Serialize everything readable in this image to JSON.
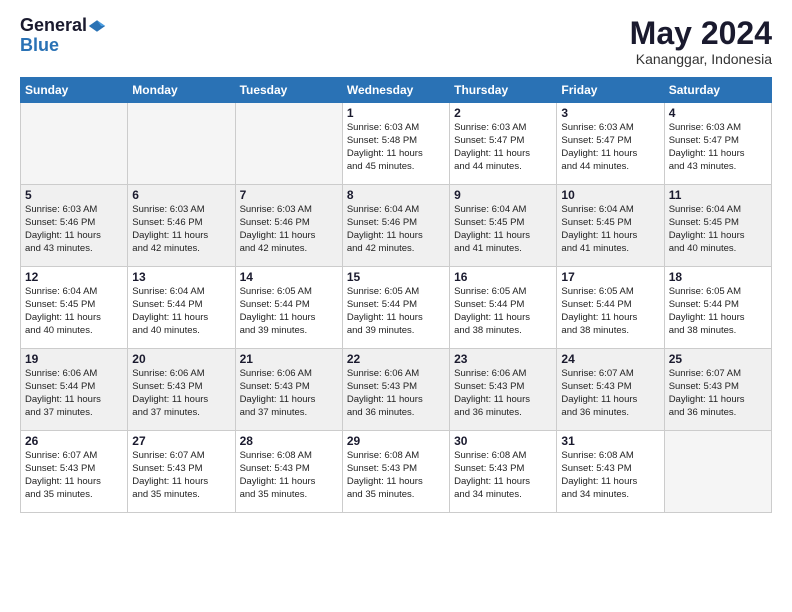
{
  "logo": {
    "general": "General",
    "blue": "Blue"
  },
  "header": {
    "month_year": "May 2024",
    "location": "Kananggar, Indonesia"
  },
  "weekdays": [
    "Sunday",
    "Monday",
    "Tuesday",
    "Wednesday",
    "Thursday",
    "Friday",
    "Saturday"
  ],
  "weeks": [
    [
      {
        "day": "",
        "info": ""
      },
      {
        "day": "",
        "info": ""
      },
      {
        "day": "",
        "info": ""
      },
      {
        "day": "1",
        "info": "Sunrise: 6:03 AM\nSunset: 5:48 PM\nDaylight: 11 hours\nand 45 minutes."
      },
      {
        "day": "2",
        "info": "Sunrise: 6:03 AM\nSunset: 5:47 PM\nDaylight: 11 hours\nand 44 minutes."
      },
      {
        "day": "3",
        "info": "Sunrise: 6:03 AM\nSunset: 5:47 PM\nDaylight: 11 hours\nand 44 minutes."
      },
      {
        "day": "4",
        "info": "Sunrise: 6:03 AM\nSunset: 5:47 PM\nDaylight: 11 hours\nand 43 minutes."
      }
    ],
    [
      {
        "day": "5",
        "info": "Sunrise: 6:03 AM\nSunset: 5:46 PM\nDaylight: 11 hours\nand 43 minutes."
      },
      {
        "day": "6",
        "info": "Sunrise: 6:03 AM\nSunset: 5:46 PM\nDaylight: 11 hours\nand 42 minutes."
      },
      {
        "day": "7",
        "info": "Sunrise: 6:03 AM\nSunset: 5:46 PM\nDaylight: 11 hours\nand 42 minutes."
      },
      {
        "day": "8",
        "info": "Sunrise: 6:04 AM\nSunset: 5:46 PM\nDaylight: 11 hours\nand 42 minutes."
      },
      {
        "day": "9",
        "info": "Sunrise: 6:04 AM\nSunset: 5:45 PM\nDaylight: 11 hours\nand 41 minutes."
      },
      {
        "day": "10",
        "info": "Sunrise: 6:04 AM\nSunset: 5:45 PM\nDaylight: 11 hours\nand 41 minutes."
      },
      {
        "day": "11",
        "info": "Sunrise: 6:04 AM\nSunset: 5:45 PM\nDaylight: 11 hours\nand 40 minutes."
      }
    ],
    [
      {
        "day": "12",
        "info": "Sunrise: 6:04 AM\nSunset: 5:45 PM\nDaylight: 11 hours\nand 40 minutes."
      },
      {
        "day": "13",
        "info": "Sunrise: 6:04 AM\nSunset: 5:44 PM\nDaylight: 11 hours\nand 40 minutes."
      },
      {
        "day": "14",
        "info": "Sunrise: 6:05 AM\nSunset: 5:44 PM\nDaylight: 11 hours\nand 39 minutes."
      },
      {
        "day": "15",
        "info": "Sunrise: 6:05 AM\nSunset: 5:44 PM\nDaylight: 11 hours\nand 39 minutes."
      },
      {
        "day": "16",
        "info": "Sunrise: 6:05 AM\nSunset: 5:44 PM\nDaylight: 11 hours\nand 38 minutes."
      },
      {
        "day": "17",
        "info": "Sunrise: 6:05 AM\nSunset: 5:44 PM\nDaylight: 11 hours\nand 38 minutes."
      },
      {
        "day": "18",
        "info": "Sunrise: 6:05 AM\nSunset: 5:44 PM\nDaylight: 11 hours\nand 38 minutes."
      }
    ],
    [
      {
        "day": "19",
        "info": "Sunrise: 6:06 AM\nSunset: 5:44 PM\nDaylight: 11 hours\nand 37 minutes."
      },
      {
        "day": "20",
        "info": "Sunrise: 6:06 AM\nSunset: 5:43 PM\nDaylight: 11 hours\nand 37 minutes."
      },
      {
        "day": "21",
        "info": "Sunrise: 6:06 AM\nSunset: 5:43 PM\nDaylight: 11 hours\nand 37 minutes."
      },
      {
        "day": "22",
        "info": "Sunrise: 6:06 AM\nSunset: 5:43 PM\nDaylight: 11 hours\nand 36 minutes."
      },
      {
        "day": "23",
        "info": "Sunrise: 6:06 AM\nSunset: 5:43 PM\nDaylight: 11 hours\nand 36 minutes."
      },
      {
        "day": "24",
        "info": "Sunrise: 6:07 AM\nSunset: 5:43 PM\nDaylight: 11 hours\nand 36 minutes."
      },
      {
        "day": "25",
        "info": "Sunrise: 6:07 AM\nSunset: 5:43 PM\nDaylight: 11 hours\nand 36 minutes."
      }
    ],
    [
      {
        "day": "26",
        "info": "Sunrise: 6:07 AM\nSunset: 5:43 PM\nDaylight: 11 hours\nand 35 minutes."
      },
      {
        "day": "27",
        "info": "Sunrise: 6:07 AM\nSunset: 5:43 PM\nDaylight: 11 hours\nand 35 minutes."
      },
      {
        "day": "28",
        "info": "Sunrise: 6:08 AM\nSunset: 5:43 PM\nDaylight: 11 hours\nand 35 minutes."
      },
      {
        "day": "29",
        "info": "Sunrise: 6:08 AM\nSunset: 5:43 PM\nDaylight: 11 hours\nand 35 minutes."
      },
      {
        "day": "30",
        "info": "Sunrise: 6:08 AM\nSunset: 5:43 PM\nDaylight: 11 hours\nand 34 minutes."
      },
      {
        "day": "31",
        "info": "Sunrise: 6:08 AM\nSunset: 5:43 PM\nDaylight: 11 hours\nand 34 minutes."
      },
      {
        "day": "",
        "info": ""
      }
    ]
  ]
}
